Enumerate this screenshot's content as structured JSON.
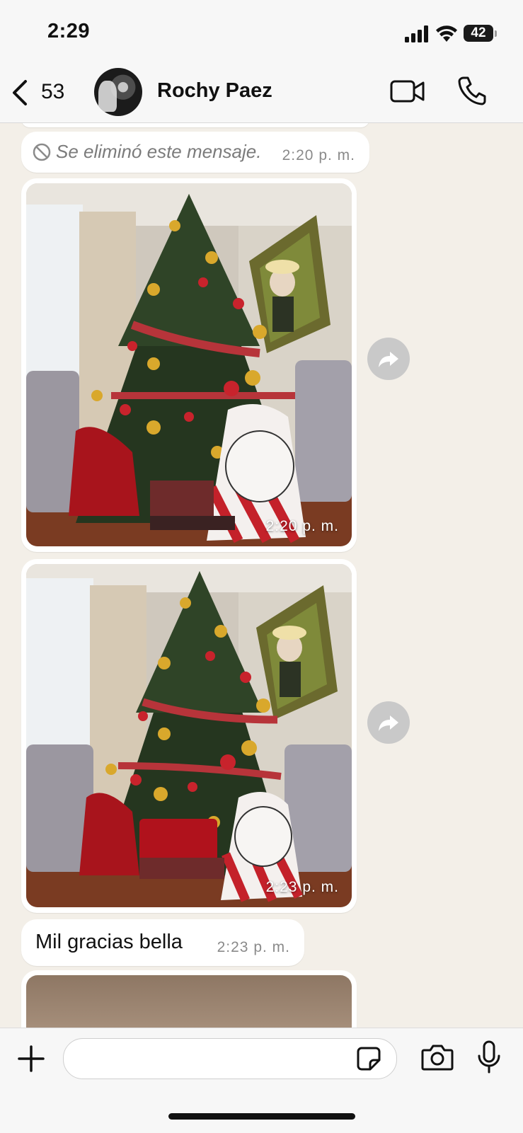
{
  "status_bar": {
    "time": "2:29",
    "battery": "42"
  },
  "header": {
    "unread_count": "53",
    "contact_name": "Rochy Paez"
  },
  "messages": {
    "deleted": {
      "text": "Se eliminó este mensaje.",
      "time": "2:20 p. m."
    },
    "photo1": {
      "time": "2:20 p. m."
    },
    "photo2": {
      "time": "2:23 p. m."
    },
    "text1": {
      "text": "Mil gracias bella",
      "time": "2:23 p. m."
    }
  },
  "input": {
    "placeholder": ""
  },
  "icons": {
    "back": "chevron-left-icon",
    "video": "video-camera-icon",
    "call": "phone-icon",
    "forward": "forward-arrow-icon",
    "deleted": "ban-icon",
    "add": "plus-icon",
    "sticker": "sticker-icon",
    "camera": "camera-icon",
    "mic": "microphone-icon"
  }
}
